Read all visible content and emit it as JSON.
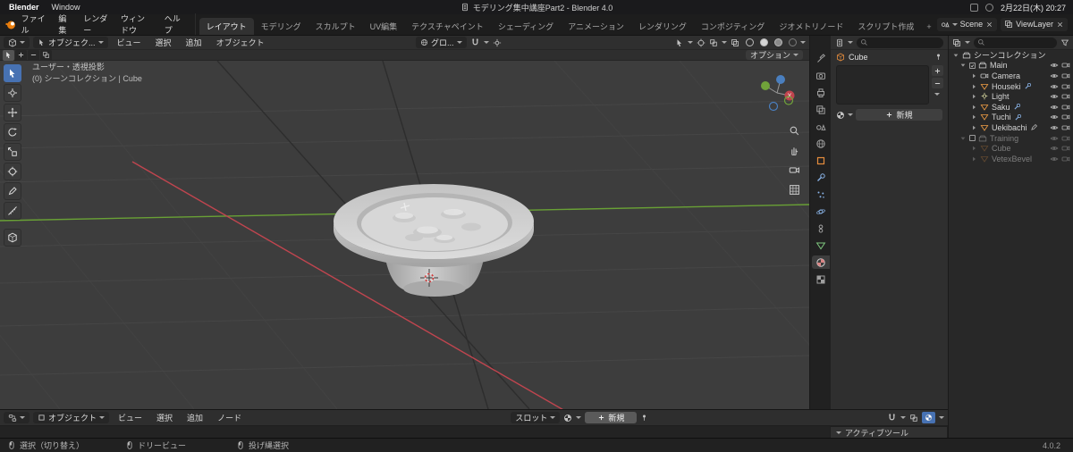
{
  "colors": {
    "accent": "#4772b3",
    "axis_x": "#c0454f",
    "axis_y": "#69a135"
  },
  "macos": {
    "app_menu": "Blender",
    "window_menu": "Window",
    "doc_title": "モデリング集中講座Part2 - Blender 4.0",
    "clock": "2月22日(木) 20:27"
  },
  "topbar": {
    "menus": [
      "ファイル",
      "編集",
      "レンダー",
      "ウィンドウ",
      "ヘルプ"
    ],
    "tabs": [
      "レイアウト",
      "モデリング",
      "スカルプト",
      "UV編集",
      "テクスチャペイント",
      "シェーディング",
      "アニメーション",
      "レンダリング",
      "コンポジティング",
      "ジオメトリノード",
      "スクリプト作成"
    ],
    "active_tab": "レイアウト",
    "add_tab_label": "+",
    "scene_label": "Scene",
    "viewlayer_label": "ViewLayer"
  },
  "viewport_header": {
    "mode": "オブジェク...",
    "menus": [
      "ビュー",
      "選択",
      "追加",
      "オブジェクト"
    ],
    "orientation": "グロ...",
    "options_label": "オプション"
  },
  "viewport": {
    "overlay_line1": "ユーザー・透視投影",
    "overlay_line2": "(0) シーンコレクション | Cube",
    "gizmo_x": "X"
  },
  "properties": {
    "breadcrumb": "Cube",
    "new_label": "新規"
  },
  "outliner": {
    "rows": [
      {
        "name": "シーンコレクション",
        "type": "collection"
      },
      {
        "name": "Main",
        "type": "collection"
      },
      {
        "name": "Camera",
        "type": "camera"
      },
      {
        "name": "Houseki",
        "type": "mesh"
      },
      {
        "name": "Light",
        "type": "light"
      },
      {
        "name": "Saku",
        "type": "mesh"
      },
      {
        "name": "Tuchi",
        "type": "mesh"
      },
      {
        "name": "Uekibachi",
        "type": "mesh"
      },
      {
        "name": "Training",
        "type": "collection",
        "excluded": true
      },
      {
        "name": "Cube",
        "type": "mesh",
        "excluded": true
      },
      {
        "name": "VetexBevel",
        "type": "mesh",
        "excluded": true
      }
    ]
  },
  "shader_editor": {
    "type_label": "オブジェクト",
    "menus": [
      "ビュー",
      "選択",
      "追加",
      "ノード"
    ],
    "slot_label": "スロット",
    "new_label": "新規",
    "sidebar_panel": "アクティブツール"
  },
  "statusbar": {
    "items": [
      "選択（切り替え）",
      "ドリービュー",
      "投げ縄選択"
    ],
    "version": "4.0.2"
  }
}
